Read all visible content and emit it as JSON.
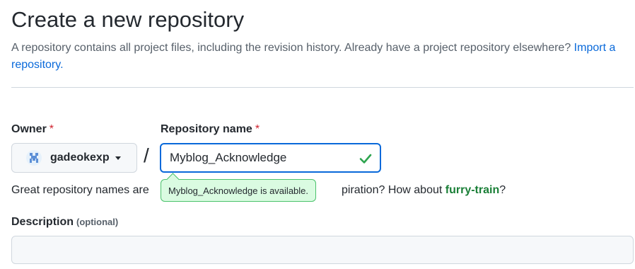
{
  "header": {
    "title": "Create a new repository",
    "subtitle": "A repository contains all project files, including the revision history. Already have a project repository elsewhere?",
    "import_link": "Import a repository."
  },
  "owner": {
    "label": "Owner",
    "required_mark": "*",
    "value": "gadeokexp"
  },
  "separator": "/",
  "repo_name": {
    "label": "Repository name",
    "required_mark": "*",
    "value": "Myblog_Acknowledge",
    "availability": "Myblog_Acknowledge is available."
  },
  "hint": {
    "prefix": "Great repository names are",
    "suffix": "piration? How about",
    "suggestion": "furry-train",
    "end": "?"
  },
  "description": {
    "label": "Description",
    "optional": "(optional)",
    "value": ""
  },
  "colors": {
    "link": "#0969da",
    "required": "#cf222e",
    "success": "#1a7f37",
    "focus_border": "#0969da"
  }
}
